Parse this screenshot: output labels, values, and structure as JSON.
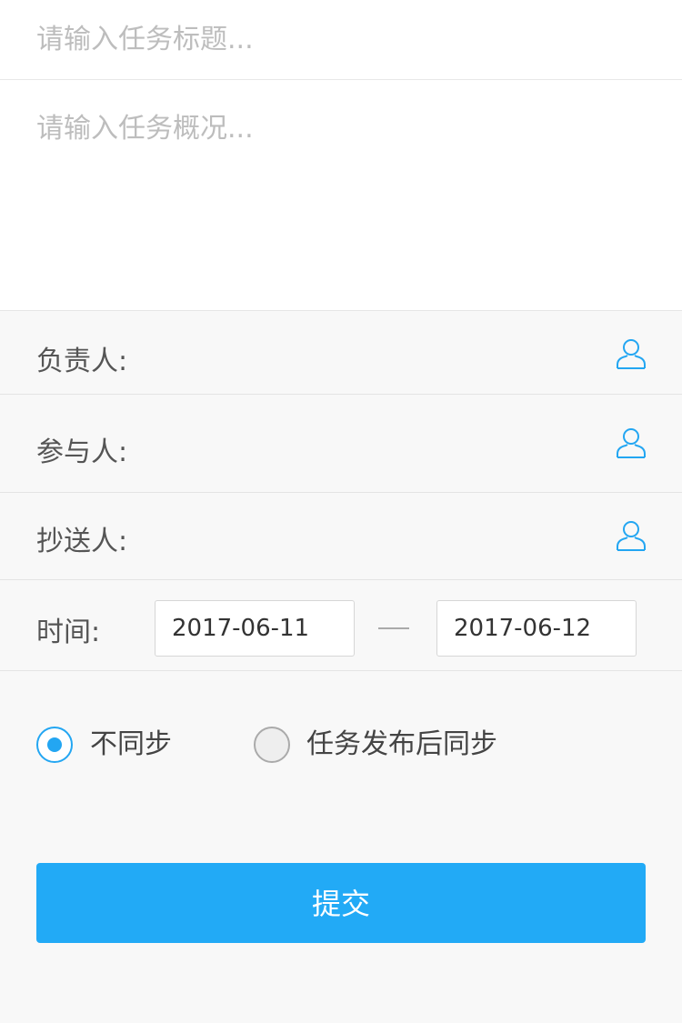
{
  "task": {
    "title_placeholder": "请输入任务标题...",
    "title_value": "",
    "summary_placeholder": "请输入任务概况...",
    "summary_value": ""
  },
  "people": {
    "owner_label": "负责人:",
    "participants_label": "参与人:",
    "cc_label": "抄送人:",
    "icon": "person-outline-icon",
    "icon_color": "#23a6f2"
  },
  "time": {
    "label": "时间:",
    "start": "2017-06-11",
    "separator": "—",
    "end": "2017-06-12"
  },
  "sync": {
    "options": [
      {
        "label": "不同步",
        "selected": true
      },
      {
        "label": "任务发布后同步",
        "selected": false
      }
    ]
  },
  "submit": {
    "label": "提交",
    "color": "#22aaf6"
  }
}
